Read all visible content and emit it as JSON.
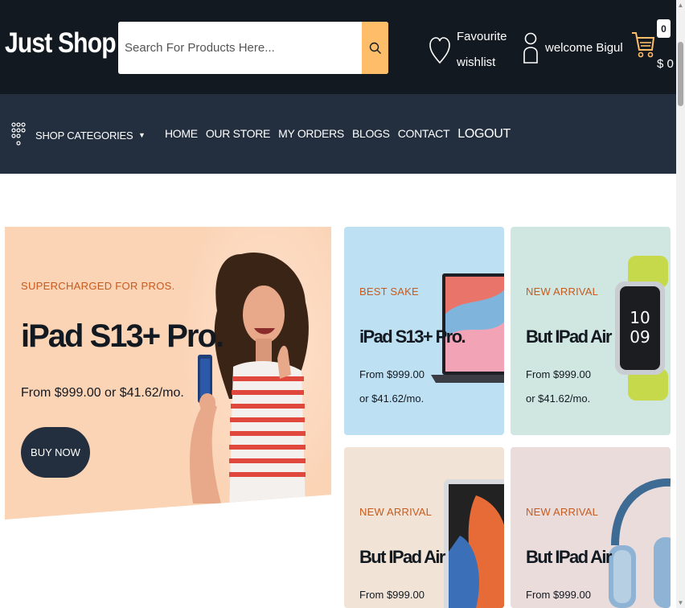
{
  "header": {
    "logo": "Just Shop",
    "search_placeholder": "Search For Products Here...",
    "wishlist_line1": "Favourite",
    "wishlist_line2": "wishlist",
    "welcome": "welcome Bigul",
    "cart_count": "0",
    "cart_total": "$ 0"
  },
  "nav": {
    "categories_label": "SHOP CATEGORIES",
    "items": [
      "HOME",
      "OUR STORE",
      "MY ORDERS",
      "BLOGS",
      "CONTACT",
      "LOGOUT"
    ]
  },
  "hero": {
    "subtitle": "SUPERCHARGED FOR PROS.",
    "title": "iPad S13+ Pro.",
    "price": "From $999.00 or $41.62/mo.",
    "button": "BUY NOW"
  },
  "cards": [
    {
      "tag": "BEST SAKE",
      "name": "iPad S13+ Pro.",
      "price1": "From $999.00",
      "price2": "or $41.62/mo.",
      "image": "laptop"
    },
    {
      "tag": "NEW ARRIVAL",
      "name": "But IPad Air",
      "price1": "From $999.00",
      "price2": "or $41.62/mo.",
      "image": "smartwatch"
    },
    {
      "tag": "NEW ARRIVAL",
      "name": "But IPad Air",
      "price1": "From $999.00",
      "price2": "",
      "image": "tablet"
    },
    {
      "tag": "NEW ARRIVAL",
      "name": "But IPad Air",
      "price1": "From $999.00",
      "price2": "",
      "image": "headphones"
    }
  ],
  "colors": {
    "header_bg": "#131921",
    "nav_bg": "#232f3e",
    "accent": "#febd69",
    "tag_orange": "#c65b1f"
  }
}
